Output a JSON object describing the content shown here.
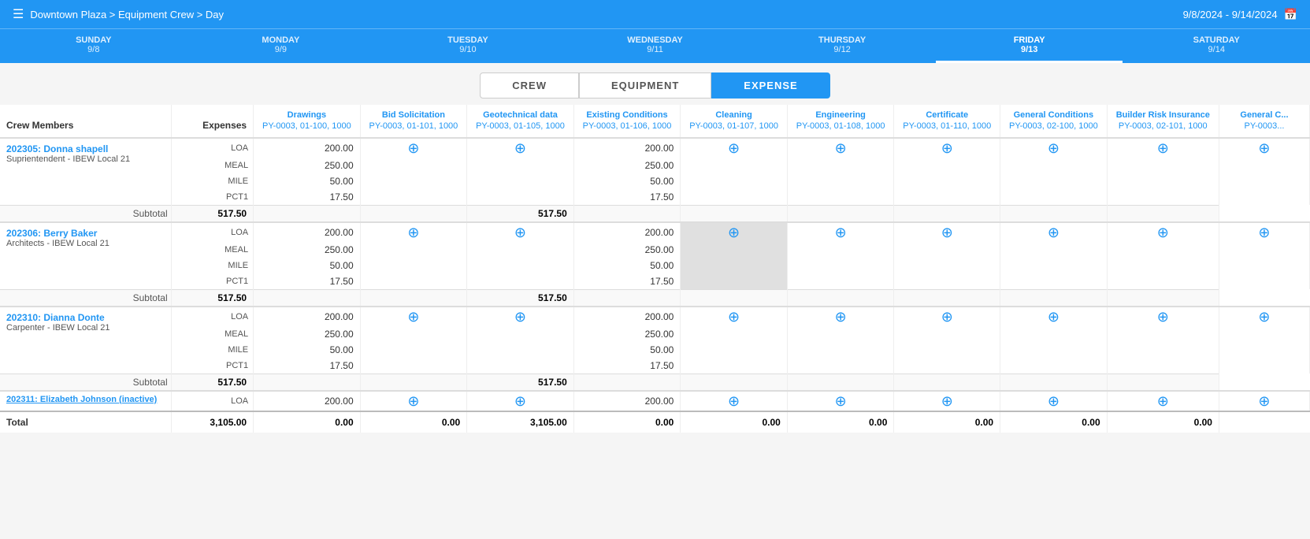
{
  "header": {
    "breadcrumb": "Downtown Plaza  >  Equipment Crew  >  Day",
    "date_range": "9/8/2024 - 9/14/2024"
  },
  "day_tabs": [
    {
      "name": "SUNDAY",
      "date": "9/8"
    },
    {
      "name": "MONDAY",
      "date": "9/9"
    },
    {
      "name": "TUESDAY",
      "date": "9/10"
    },
    {
      "name": "WEDNESDAY",
      "date": "9/11"
    },
    {
      "name": "THURSDAY",
      "date": "9/12"
    },
    {
      "name": "FRIDAY",
      "date": "9/13",
      "active": true
    },
    {
      "name": "SATURDAY",
      "date": "9/14"
    }
  ],
  "view_tabs": [
    {
      "label": "CREW"
    },
    {
      "label": "EQUIPMENT"
    },
    {
      "label": "EXPENSE",
      "active": true
    }
  ],
  "columns": {
    "crew_members": "Crew Members",
    "expenses": "Expenses",
    "cols": [
      {
        "title": "Drawings",
        "sub": "PY-0003, 01-100, 1000"
      },
      {
        "title": "Bid Solicitation",
        "sub": "PY-0003, 01-101, 1000"
      },
      {
        "title": "Geotechnical data",
        "sub": "PY-0003, 01-105, 1000"
      },
      {
        "title": "Existing Conditions",
        "sub": "PY-0003, 01-106, 1000"
      },
      {
        "title": "Cleaning",
        "sub": "PY-0003, 01-107, 1000"
      },
      {
        "title": "Engineering",
        "sub": "PY-0003, 01-108, 1000"
      },
      {
        "title": "Certificate",
        "sub": "PY-0003, 01-110, 1000"
      },
      {
        "title": "General Conditions",
        "sub": "PY-0003, 02-100, 1000"
      },
      {
        "title": "Builder Risk Insurance",
        "sub": "PY-0003, 02-101, 1000"
      },
      {
        "title": "General C...",
        "sub": "PY-0003..."
      }
    ]
  },
  "crew_members": [
    {
      "id": "202305",
      "name": "Donna shapell",
      "role": "Suprientendent - IBEW Local 21",
      "expenses": [
        {
          "type": "LOA",
          "amount": "200.00"
        },
        {
          "type": "MEAL",
          "amount": "250.00"
        },
        {
          "type": "MILE",
          "amount": "50.00"
        },
        {
          "type": "PCT1",
          "amount": "17.50"
        }
      ],
      "subtotal": "517.50",
      "col_values": [
        "",
        "",
        "",
        "200.00\n250.00\n50.00\n17.50",
        "",
        "",
        "",
        "",
        "",
        ""
      ]
    },
    {
      "id": "202306",
      "name": "Berry Baker",
      "role": "Architects - IBEW Local 21",
      "expenses": [
        {
          "type": "LOA",
          "amount": "200.00"
        },
        {
          "type": "MEAL",
          "amount": "250.00"
        },
        {
          "type": "MILE",
          "amount": "50.00"
        },
        {
          "type": "PCT1",
          "amount": "17.50"
        }
      ],
      "subtotal": "517.50",
      "col_values": [
        "",
        "",
        "",
        "200.00\n250.00\n50.00\n17.50",
        "",
        "",
        "",
        "",
        "",
        ""
      ],
      "highlighted_col": 4
    },
    {
      "id": "202310",
      "name": "Dianna Donte",
      "role": "Carpenter - IBEW Local 21",
      "expenses": [
        {
          "type": "LOA",
          "amount": "200.00"
        },
        {
          "type": "MEAL",
          "amount": "250.00"
        },
        {
          "type": "MILE",
          "amount": "50.00"
        },
        {
          "type": "PCT1",
          "amount": "17.50"
        }
      ],
      "subtotal": "517.50",
      "col_values": [
        "",
        "",
        "",
        "200.00\n250.00\n50.00\n17.50",
        "",
        "",
        "",
        "",
        "",
        ""
      ]
    },
    {
      "id": "202311",
      "name": "Elizabeth Johnson (inactive)",
      "role": "",
      "partial": true,
      "expenses": [
        {
          "type": "LOA",
          "amount": "200.00"
        }
      ],
      "col_values": [
        "",
        "",
        "",
        "200.00",
        "",
        "",
        "",
        "",
        "",
        ""
      ]
    }
  ],
  "totals": {
    "label": "Total",
    "expenses": "3,105.00",
    "col_totals": [
      "0.00",
      "0.00",
      "3,105.00",
      "0.00",
      "0.00",
      "0.00",
      "0.00",
      "0.00",
      "0.00"
    ]
  }
}
